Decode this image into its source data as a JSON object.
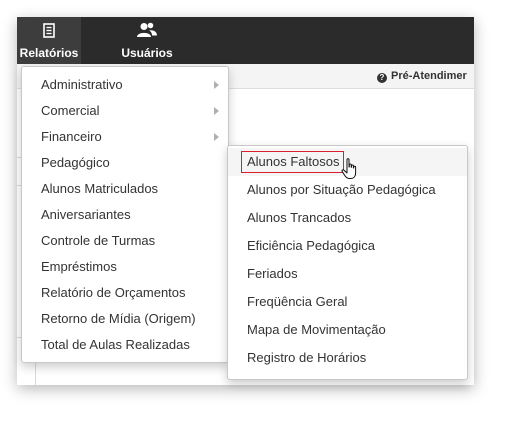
{
  "nav": {
    "items": [
      {
        "label": "Relatórios",
        "icon": "document-icon",
        "active": true
      },
      {
        "label": "Usuários",
        "icon": "users-icon",
        "active": false
      }
    ]
  },
  "subbar": {
    "label": "Pré-Atendimer",
    "icon": "info-icon"
  },
  "menu": {
    "items": [
      {
        "label": "Administrativo",
        "has_submenu": true
      },
      {
        "label": "Comercial",
        "has_submenu": true
      },
      {
        "label": "Financeiro",
        "has_submenu": true
      },
      {
        "label": "Pedagógico",
        "has_submenu": false
      },
      {
        "label": "Alunos Matriculados",
        "has_submenu": false
      },
      {
        "label": "Aniversariantes",
        "has_submenu": false
      },
      {
        "label": "Controle de Turmas",
        "has_submenu": false
      },
      {
        "label": "Empréstimos",
        "has_submenu": false
      },
      {
        "label": "Relatório de Orçamentos",
        "has_submenu": false
      },
      {
        "label": "Retorno de Mídia (Origem)",
        "has_submenu": false
      },
      {
        "label": "Total de Aulas Realizadas",
        "has_submenu": false
      }
    ]
  },
  "submenu": {
    "items": [
      {
        "label": "Alunos Faltosos",
        "highlighted": true
      },
      {
        "label": "Alunos por Situação Pedagógica"
      },
      {
        "label": "Alunos Trancados"
      },
      {
        "label": "Eficiência Pedagógica"
      },
      {
        "label": "Feriados"
      },
      {
        "label": "Freqüência Geral"
      },
      {
        "label": "Mapa de Movimentação"
      },
      {
        "label": "Registro de Horários"
      }
    ]
  },
  "colors": {
    "navbar": "#2b2b2b",
    "highlight_border": "#d9202c",
    "text": "#333333"
  }
}
